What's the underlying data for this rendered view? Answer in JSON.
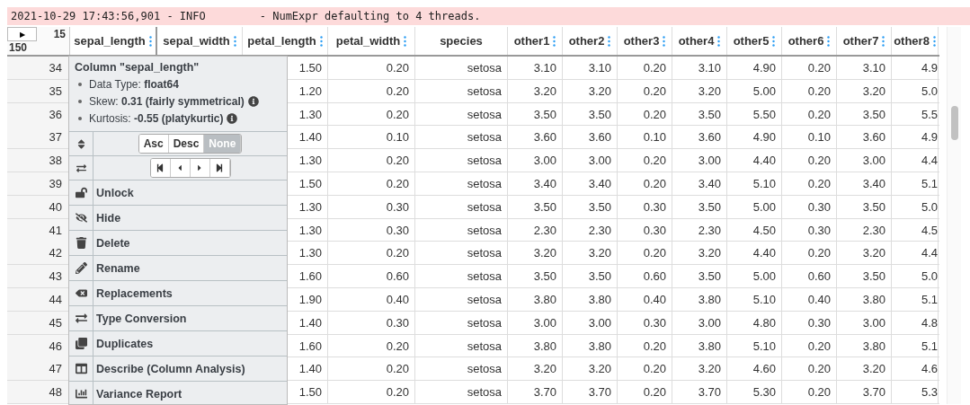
{
  "log": {
    "source": "2021-10-29 17:43:56,901 - INFO",
    "message": "- NumExpr defaulting to 4 threads."
  },
  "corner": {
    "toggle": "▶",
    "column_count": "15",
    "row_count": "150"
  },
  "columns": [
    {
      "label": "sepal_length",
      "menu": true
    },
    {
      "label": "sepal_width",
      "menu": true
    },
    {
      "label": "petal_length",
      "menu": true
    },
    {
      "label": "petal_width",
      "menu": true
    },
    {
      "label": "species",
      "menu": false
    },
    {
      "label": "other1",
      "menu": true
    },
    {
      "label": "other2",
      "menu": true
    },
    {
      "label": "other3",
      "menu": true
    },
    {
      "label": "other4",
      "menu": true
    },
    {
      "label": "other5",
      "menu": true
    },
    {
      "label": "other6",
      "menu": true
    },
    {
      "label": "other7",
      "menu": true
    },
    {
      "label": "other8",
      "menu": true
    }
  ],
  "rows": [
    {
      "index": "34",
      "cells": [
        "1.50",
        "0.20",
        "setosa",
        "3.10",
        "3.10",
        "0.20",
        "3.10",
        "4.90",
        "0.20",
        "3.10",
        "4.9"
      ]
    },
    {
      "index": "35",
      "cells": [
        "1.20",
        "0.20",
        "setosa",
        "3.20",
        "3.20",
        "0.20",
        "3.20",
        "5.00",
        "0.20",
        "3.20",
        "5.0"
      ]
    },
    {
      "index": "36",
      "cells": [
        "1.30",
        "0.20",
        "setosa",
        "3.50",
        "3.50",
        "0.20",
        "3.50",
        "5.50",
        "0.20",
        "3.50",
        "5.5"
      ]
    },
    {
      "index": "37",
      "cells": [
        "1.40",
        "0.10",
        "setosa",
        "3.60",
        "3.60",
        "0.10",
        "3.60",
        "4.90",
        "0.10",
        "3.60",
        "4.9"
      ]
    },
    {
      "index": "38",
      "cells": [
        "1.30",
        "0.20",
        "setosa",
        "3.00",
        "3.00",
        "0.20",
        "3.00",
        "4.40",
        "0.20",
        "3.00",
        "4.4"
      ]
    },
    {
      "index": "39",
      "cells": [
        "1.50",
        "0.20",
        "setosa",
        "3.40",
        "3.40",
        "0.20",
        "3.40",
        "5.10",
        "0.20",
        "3.40",
        "5.1"
      ]
    },
    {
      "index": "40",
      "cells": [
        "1.30",
        "0.30",
        "setosa",
        "3.50",
        "3.50",
        "0.30",
        "3.50",
        "5.00",
        "0.30",
        "3.50",
        "5.0"
      ]
    },
    {
      "index": "41",
      "cells": [
        "1.30",
        "0.30",
        "setosa",
        "2.30",
        "2.30",
        "0.30",
        "2.30",
        "4.50",
        "0.30",
        "2.30",
        "4.5"
      ]
    },
    {
      "index": "42",
      "cells": [
        "1.30",
        "0.20",
        "setosa",
        "3.20",
        "3.20",
        "0.20",
        "3.20",
        "4.40",
        "0.20",
        "3.20",
        "4.4"
      ]
    },
    {
      "index": "43",
      "cells": [
        "1.60",
        "0.60",
        "setosa",
        "3.50",
        "3.50",
        "0.60",
        "3.50",
        "5.00",
        "0.60",
        "3.50",
        "5.0"
      ]
    },
    {
      "index": "44",
      "cells": [
        "1.90",
        "0.40",
        "setosa",
        "3.80",
        "3.80",
        "0.40",
        "3.80",
        "5.10",
        "0.40",
        "3.80",
        "5.1"
      ]
    },
    {
      "index": "45",
      "cells": [
        "1.40",
        "0.30",
        "setosa",
        "3.00",
        "3.00",
        "0.30",
        "3.00",
        "4.80",
        "0.30",
        "3.00",
        "4.8"
      ]
    },
    {
      "index": "46",
      "cells": [
        "1.60",
        "0.20",
        "setosa",
        "3.80",
        "3.80",
        "0.20",
        "3.80",
        "5.10",
        "0.20",
        "3.80",
        "5.1"
      ]
    },
    {
      "index": "47",
      "cells": [
        "1.40",
        "0.20",
        "setosa",
        "3.20",
        "3.20",
        "0.20",
        "3.20",
        "4.60",
        "0.20",
        "3.20",
        "4.6"
      ]
    },
    {
      "index": "48",
      "cells": [
        "1.50",
        "0.20",
        "setosa",
        "3.70",
        "3.70",
        "0.20",
        "3.70",
        "5.30",
        "0.20",
        "3.70",
        "5.3"
      ]
    }
  ],
  "column_menu": {
    "title": "Column \"sepal_length\"",
    "stats": [
      {
        "label": "Data Type:",
        "value": "float64",
        "info": false
      },
      {
        "label": "Skew:",
        "value": "0.31 (fairly symmetrical)",
        "info": true
      },
      {
        "label": "Kurtosis:",
        "value": "-0.55 (platykurtic)",
        "info": true
      }
    ],
    "sort_buttons": [
      {
        "label": "Asc",
        "selected": false
      },
      {
        "label": "Desc",
        "selected": false
      },
      {
        "label": "None",
        "selected": true
      }
    ],
    "move_buttons": [
      {
        "kind": "first"
      },
      {
        "kind": "prev"
      },
      {
        "kind": "next"
      },
      {
        "kind": "last"
      }
    ],
    "items": [
      {
        "kind": "unlock",
        "label": "Unlock"
      },
      {
        "kind": "hide",
        "label": "Hide"
      },
      {
        "kind": "delete",
        "label": "Delete"
      },
      {
        "kind": "rename",
        "label": "Rename"
      },
      {
        "kind": "replacements",
        "label": "Replacements"
      },
      {
        "kind": "conversion",
        "label": "Type Conversion"
      },
      {
        "kind": "duplicates",
        "label": "Duplicates"
      },
      {
        "kind": "describe",
        "label": "Describe (Column Analysis)"
      },
      {
        "kind": "variance",
        "label": "Variance Report"
      }
    ]
  }
}
